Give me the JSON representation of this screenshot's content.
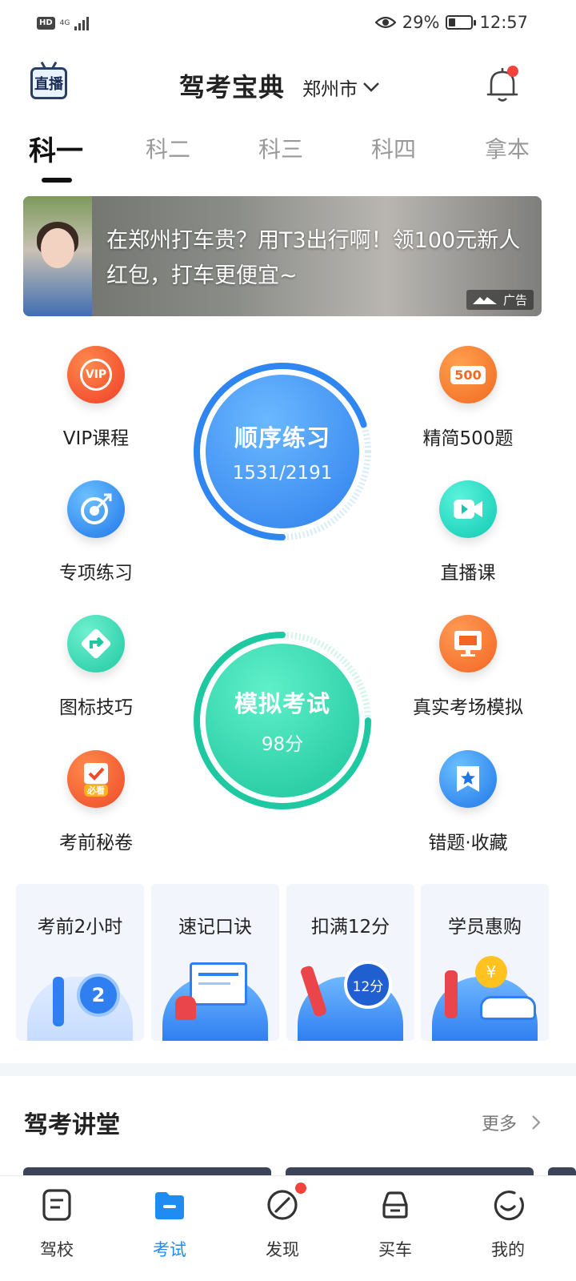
{
  "status_bar": {
    "hd": "HD",
    "network": "4G",
    "battery": "29%",
    "time": "12:57",
    "battery_level": 0.29
  },
  "header": {
    "live_logo": "直播",
    "title": "驾考宝典",
    "city": "郑州市"
  },
  "tabs": [
    "科一",
    "科二",
    "科三",
    "科四",
    "拿本"
  ],
  "ad": {
    "text": "在郑州打车贵？用T3出行啊！领100元新人红包，打车更便宜~",
    "tag": "广告"
  },
  "features": {
    "vip": "VIP课程",
    "vip_badge": "VIP",
    "topic": "专项练习",
    "signs": "图标技巧",
    "secret": "考前秘卷",
    "secret_badge": "必看",
    "simple500": "精简500题",
    "simple500_badge": "500",
    "live_class": "直播课",
    "real_exam": "真实考场模拟",
    "wrong_fav": "错题·收藏"
  },
  "practice": {
    "title": "顺序练习",
    "progress": "1531/2191",
    "done": 1531,
    "total": 2191
  },
  "mock": {
    "title": "模拟考试",
    "score": "98分"
  },
  "cards": [
    {
      "title": "考前2小时",
      "badge": "2"
    },
    {
      "title": "速记口诀"
    },
    {
      "title": "扣满12分",
      "badge": "12分"
    },
    {
      "title": "学员惠购",
      "badge": "¥"
    }
  ],
  "section": {
    "title": "驾考讲堂",
    "more": "更多"
  },
  "bottom_nav": [
    "驾校",
    "考试",
    "发现",
    "买车",
    "我的"
  ],
  "colors": {
    "accent": "#1e8cf0",
    "red_dot": "#f3433a",
    "practice": "#2f86f0",
    "mock": "#1ec9a2"
  },
  "icons": [
    "hd-badge",
    "signal-icon",
    "eye-icon",
    "battery-icon",
    "live-logo",
    "chevron-down-icon",
    "bell-icon",
    "vip-icon",
    "target-icon",
    "turn-sign-icon",
    "check-paper-icon",
    "500-badge-icon",
    "video-icon",
    "monitor-icon",
    "star-bookmark-icon",
    "chevron-right-icon",
    "school-icon",
    "exam-folder-icon",
    "compass-icon",
    "car-icon",
    "smile-icon"
  ]
}
